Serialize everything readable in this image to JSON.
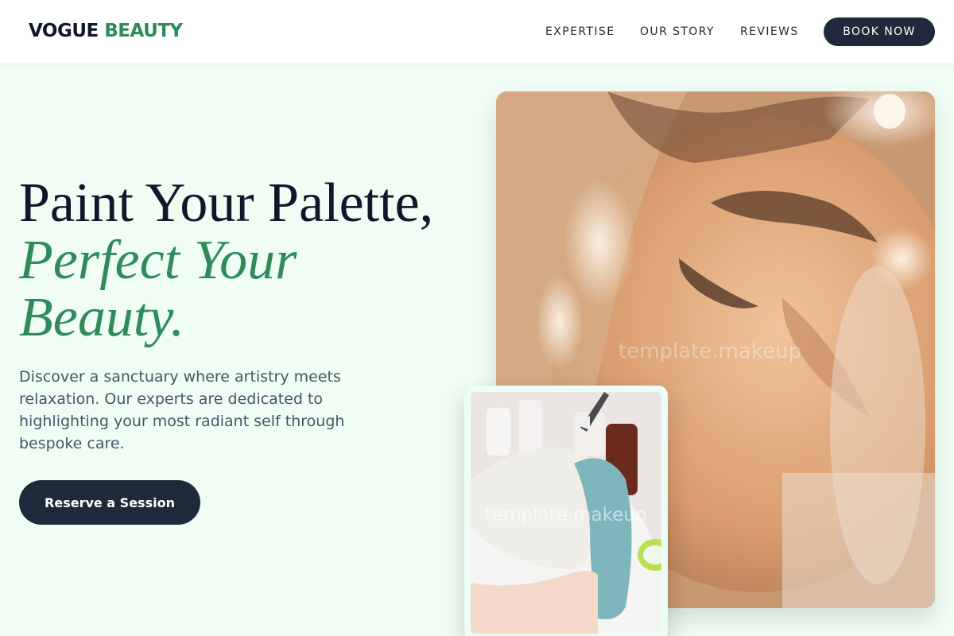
{
  "header": {
    "logo_part1": "VOGUE",
    "logo_part2": "BEAUTY",
    "nav": [
      "EXPERTISE",
      "OUR STORY",
      "REVIEWS"
    ],
    "cta": "BOOK NOW"
  },
  "hero": {
    "headline_line1": "Paint Your Palette,",
    "headline_line2": "Perfect Your",
    "headline_line3": "Beauty.",
    "description": "Discover a sanctuary where artistry meets relaxation. Our experts are dedicated to highlighting your most radiant self through bespoke care.",
    "cta": "Reserve a Session"
  },
  "images": {
    "main_watermark": "template.makeup",
    "inset_watermark": "template.makeup"
  },
  "colors": {
    "accent": "#2f8a5c",
    "dark": "#1e293b",
    "background": "#f0fdf4"
  }
}
